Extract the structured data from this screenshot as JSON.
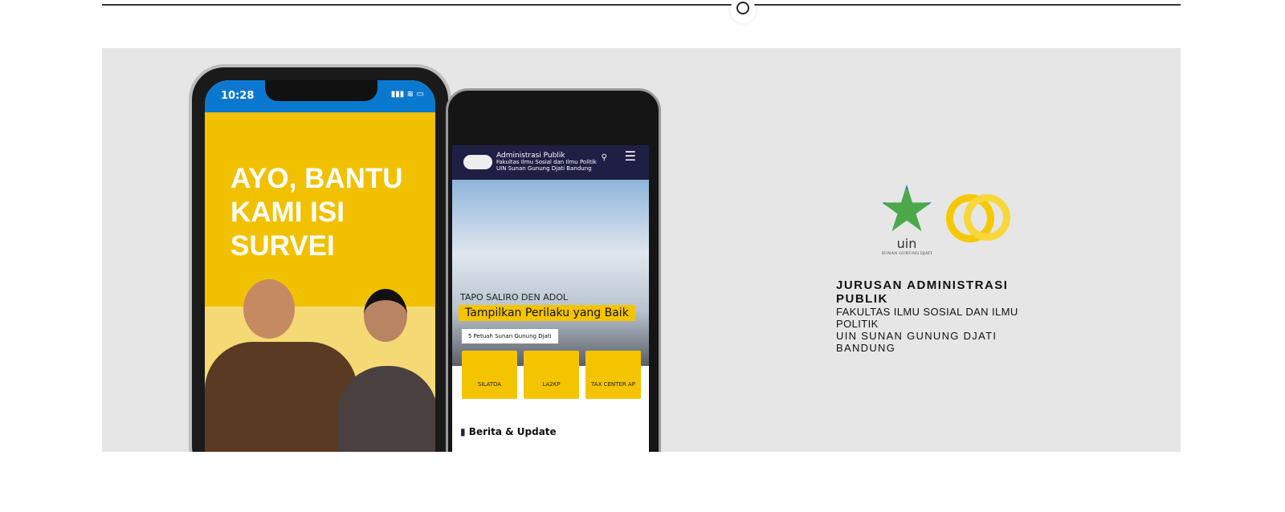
{
  "phone_left": {
    "time": "10:28",
    "status_icons": "▮▮▮ ≋ ▭",
    "headline": "AYO, BANTU\nKAMI ISI\nSURVEI"
  },
  "phone_right": {
    "site_title": "Administrasi Publik",
    "site_subtitle_1": "Fakultas Ilmu Sosial dan Ilmu Politik",
    "site_subtitle_2": "UIN Sunan Gunung Djati Bandung",
    "kicker": "TAPO SALIRO DEN ADOL",
    "headline": "Tampilkan Perilaku yang Baik",
    "sub": "5 Petuah Sunan Gunung Djati",
    "tiles": [
      {
        "label": "SILATDA"
      },
      {
        "label": "LA2KP"
      },
      {
        "label": "TAX CENTER AP"
      }
    ],
    "section": "Berita & Update"
  },
  "branding": {
    "uin_logo_text": "uin",
    "uin_logo_sub": "SUNAN GUNUNG DJATI",
    "line1": "JURUSAN ADMINISTRASI PUBLIK",
    "line2": "FAKULTAS ILMU SOSIAL DAN ILMU POLITIK",
    "line3": "UIN SUNAN GUNUNG DJATI BANDUNG"
  },
  "colors": {
    "accent_yellow": "#f1c100",
    "navy": "#1f1f45",
    "status_blue": "#0b78d0",
    "banner_bg": "#e6e6e6"
  }
}
